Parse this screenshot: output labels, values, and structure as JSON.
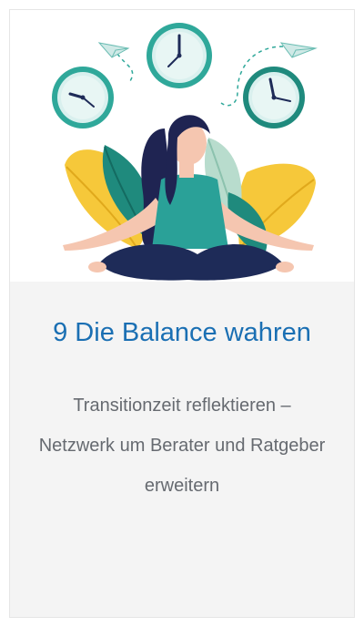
{
  "card": {
    "title": "9 Die Balance wahren",
    "description": "Transitionzeit reflektieren – Netzwerk um Berater und Ratgeber erweitern",
    "illustration": {
      "subject": "woman-meditating-with-clocks",
      "icons": [
        "clock-icon",
        "clock-icon",
        "clock-icon",
        "paper-plane-icon",
        "paper-plane-icon"
      ]
    }
  },
  "colors": {
    "title": "#1a6fb3",
    "text": "#666a70",
    "panel": "#f4f4f4",
    "clock_ring": "#2fa89a",
    "leaf_yellow": "#f6c83a",
    "leaf_teal": "#1f8a7d",
    "shirt": "#2aa198",
    "pants": "#1e2b58",
    "hair": "#1f2452"
  }
}
